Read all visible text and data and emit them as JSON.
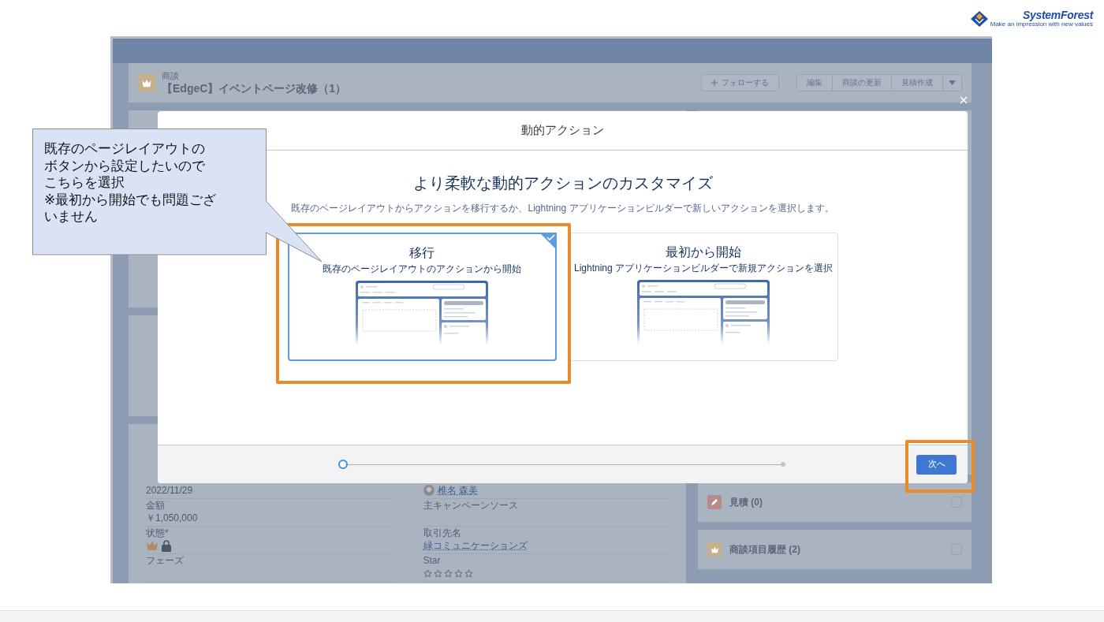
{
  "logo": {
    "name": "SystemForest",
    "tagline": "Make an impression with new values"
  },
  "record": {
    "object_label": "商談",
    "title": "【EdgeC】イベントページ改修（1）",
    "follow_button": "フォローする",
    "actions": [
      "編集",
      "商談の更新",
      "見積作成"
    ]
  },
  "details": {
    "rows": [
      {
        "left": {
          "kind": "text",
          "value": "2022/11/29"
        },
        "right": {
          "kind": "user",
          "value": "椎名 森美"
        }
      },
      {
        "left": {
          "kind": "text",
          "label": "金額",
          "value": "￥1,050,000"
        },
        "right": {
          "kind": "text",
          "label": "主キャンペーンソース"
        }
      },
      {
        "left": {
          "kind": "icons",
          "label": "状態*"
        },
        "right": {
          "kind": "link",
          "label": "取引先名",
          "value": "緑コミュニケーションズ"
        }
      },
      {
        "left": {
          "kind": "text",
          "label": "フェーズ"
        },
        "right": {
          "kind": "stars",
          "label": "Star",
          "stars": 0
        }
      }
    ]
  },
  "related_lists": [
    {
      "kind": "quote",
      "title": "見積 (0)"
    },
    {
      "kind": "opportunity",
      "title": "商談項目履歴 (2)"
    }
  ],
  "modal": {
    "title": "動的アクション",
    "heading": "より柔軟な動的アクションのカスタマイズ",
    "description": "既存のページレイアウトからアクションを移行するか、Lightning アプリケーションビルダーで新しいアクションを選択します。",
    "options": [
      {
        "title": "移行",
        "subtitle": "既存のページレイアウトのアクションから開始",
        "selected": true
      },
      {
        "title": "最初から開始",
        "subtitle": "Lightning アプリケーションビルダーで新規アクションを選択",
        "selected": false
      }
    ],
    "steps": [
      {
        "selected": true
      },
      {
        "selected": false
      }
    ],
    "next_button": "次へ"
  },
  "callout": {
    "lines": [
      "既存のページレイアウトの",
      "ボタンから設定したいので",
      "こちらを選択",
      "※最初から開始でも問題ござ",
      "いません"
    ]
  }
}
